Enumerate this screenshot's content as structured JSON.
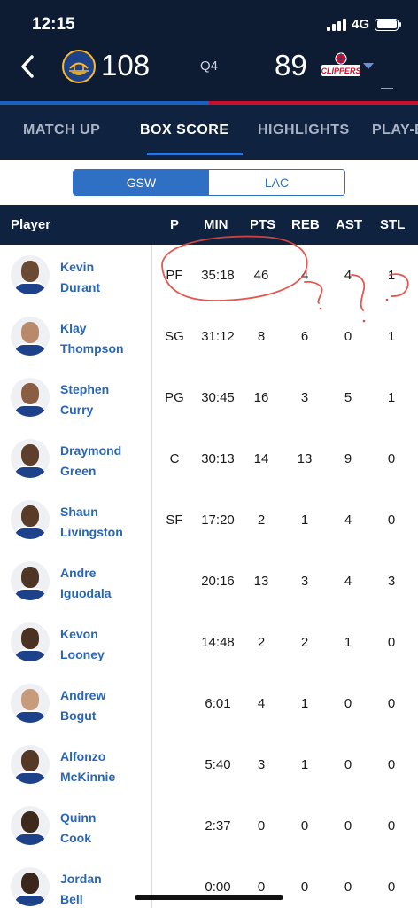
{
  "status_bar": {
    "time": "12:15",
    "network": "4G"
  },
  "scoreboard": {
    "home_score": "108",
    "period": "Q4",
    "away_score": "89",
    "home_team_logo": "Golden State Warriors logo",
    "away_team_logo": "LA Clippers logo",
    "away_logo_text": "CLIPPERS",
    "home_logo_text": "WARRIORS"
  },
  "tabs": [
    {
      "label": "MATCH UP"
    },
    {
      "label": "BOX SCORE"
    },
    {
      "label": "HIGHLIGHTS"
    },
    {
      "label": "PLAY-B"
    }
  ],
  "team_toggle": {
    "selected": "GSW",
    "other": "LAC"
  },
  "table": {
    "headers": [
      "Player",
      "P",
      "MIN",
      "PTS",
      "REB",
      "AST",
      "STL"
    ],
    "rows": [
      {
        "first": "Kevin",
        "last": "Durant",
        "pos": "PF",
        "min": "35:18",
        "pts": "46",
        "reb": "4",
        "ast": "4",
        "stl": "1"
      },
      {
        "first": "Klay",
        "last": "Thompson",
        "pos": "SG",
        "min": "31:12",
        "pts": "8",
        "reb": "6",
        "ast": "0",
        "stl": "1"
      },
      {
        "first": "Stephen",
        "last": "Curry",
        "pos": "PG",
        "min": "30:45",
        "pts": "16",
        "reb": "3",
        "ast": "5",
        "stl": "1"
      },
      {
        "first": "Draymond",
        "last": "Green",
        "pos": "C",
        "min": "30:13",
        "pts": "14",
        "reb": "13",
        "ast": "9",
        "stl": "0"
      },
      {
        "first": "Shaun",
        "last": "Livingston",
        "pos": "SF",
        "min": "17:20",
        "pts": "2",
        "reb": "1",
        "ast": "4",
        "stl": "0"
      },
      {
        "first": "Andre",
        "last": "Iguodala",
        "pos": "",
        "min": "20:16",
        "pts": "13",
        "reb": "3",
        "ast": "4",
        "stl": "3"
      },
      {
        "first": "Kevon",
        "last": "Looney",
        "pos": "",
        "min": "14:48",
        "pts": "2",
        "reb": "2",
        "ast": "1",
        "stl": "0"
      },
      {
        "first": "Andrew",
        "last": "Bogut",
        "pos": "",
        "min": "6:01",
        "pts": "4",
        "reb": "1",
        "ast": "0",
        "stl": "0"
      },
      {
        "first": "Alfonzo",
        "last": "McKinnie",
        "pos": "",
        "min": "5:40",
        "pts": "3",
        "reb": "1",
        "ast": "0",
        "stl": "0"
      },
      {
        "first": "Quinn",
        "last": "Cook",
        "pos": "",
        "min": "2:37",
        "pts": "0",
        "reb": "0",
        "ast": "0",
        "stl": "0"
      },
      {
        "first": "Jordan",
        "last": "Bell",
        "pos": "",
        "min": "0:00",
        "pts": "0",
        "reb": "0",
        "ast": "0",
        "stl": "0"
      }
    ]
  },
  "colors": {
    "header_bg": "#0d1b33",
    "tab_bg": "#0f2240",
    "accent_blue": "#2f6fc4",
    "accent_red": "#c8102e",
    "player_name": "#2a66b6",
    "annotation": "#e0473e"
  }
}
